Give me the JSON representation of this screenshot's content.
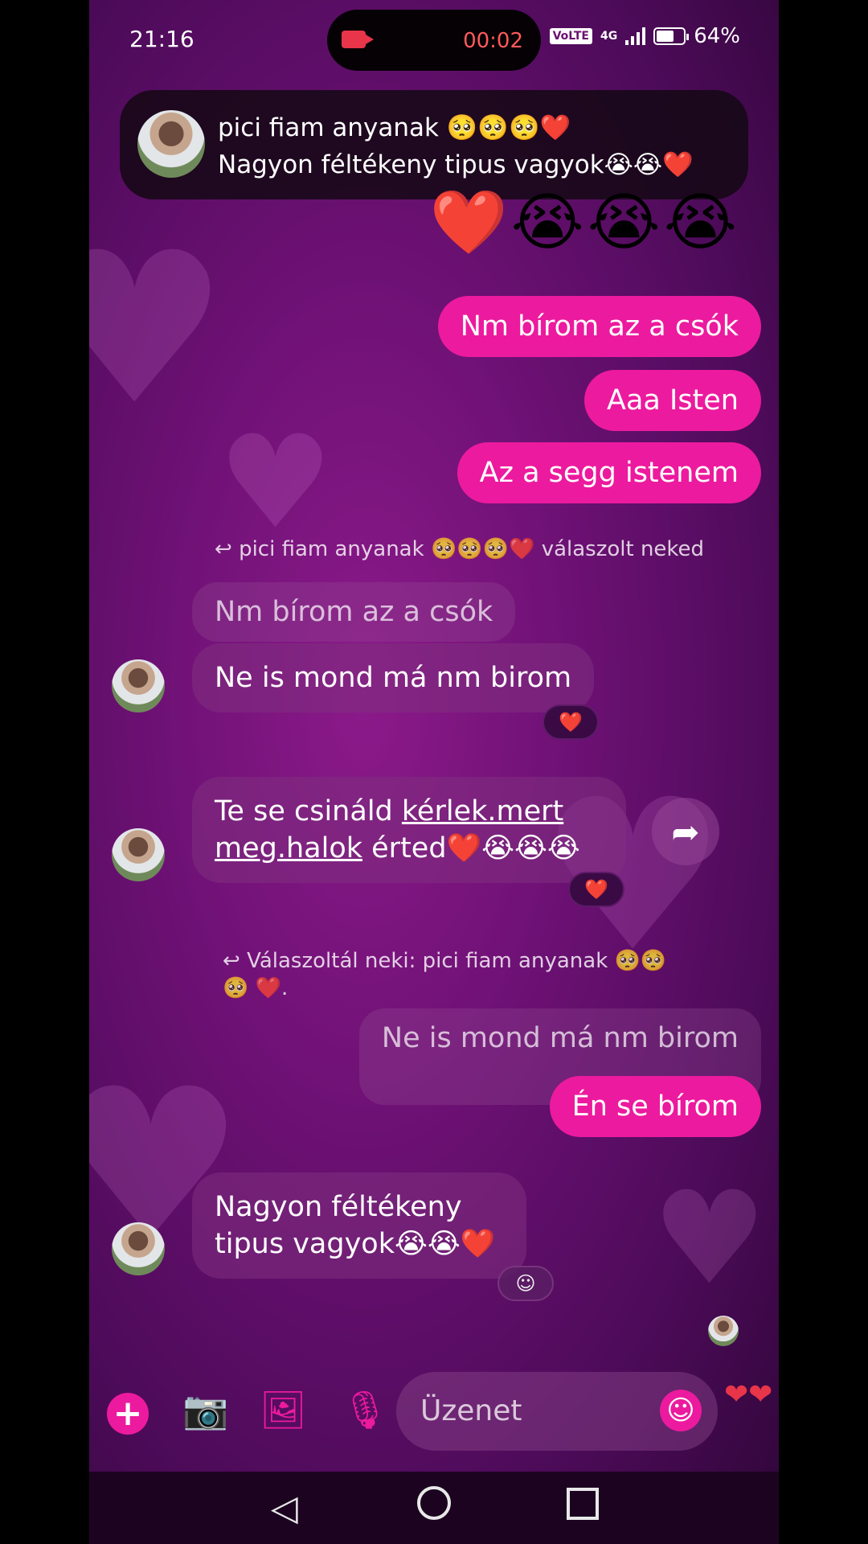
{
  "status_bar": {
    "time": "21:16",
    "recording_time": "00:02",
    "volte": "VoLTE",
    "network": "4G",
    "battery": "64%"
  },
  "notification": {
    "sender": "pici fiam anyanak 🥺🥺🥺❤️",
    "message": "Nagyon féltékeny tipus vagyok😭😭❤️"
  },
  "emoji_message": "❤️😭😭😭",
  "sent_messages": [
    "Nm bírom az a csók",
    "Aaa Isten",
    "Az a segg istenem"
  ],
  "reply_info_1": "pici fiam anyanak 🥺🥺🥺❤️ válaszolt neked",
  "quoted_1": "Nm bírom az a csók",
  "recv_1": "Ne is mond má nm birom",
  "reaction_1": "❤️",
  "recv_2": {
    "part1": "Te se csináld ",
    "link1": "kérlek.mert",
    "link2": "meg.halok",
    "part2": " érted❤️😭😭😭"
  },
  "reaction_2": "❤️",
  "reply_info_2": "Válaszoltál neki: pici fiam anyanak 🥺🥺🥺 ❤️.",
  "quoted_2": "Ne is mond má nm birom",
  "sent_4": "Én se bírom",
  "recv_3": "Nagyon féltékeny tipus vagyok😭😭❤️",
  "composer": {
    "placeholder": "Üzenet"
  },
  "icons": {
    "add": "plus-icon",
    "camera": "camera-icon",
    "gallery": "image-icon",
    "mic": "microphone-icon",
    "emoji": "smiley-icon",
    "hearts": "hearts-icon",
    "forward": "share-arrow-icon"
  },
  "colors": {
    "accent": "#ec1a9e",
    "background": "#6e1175"
  }
}
